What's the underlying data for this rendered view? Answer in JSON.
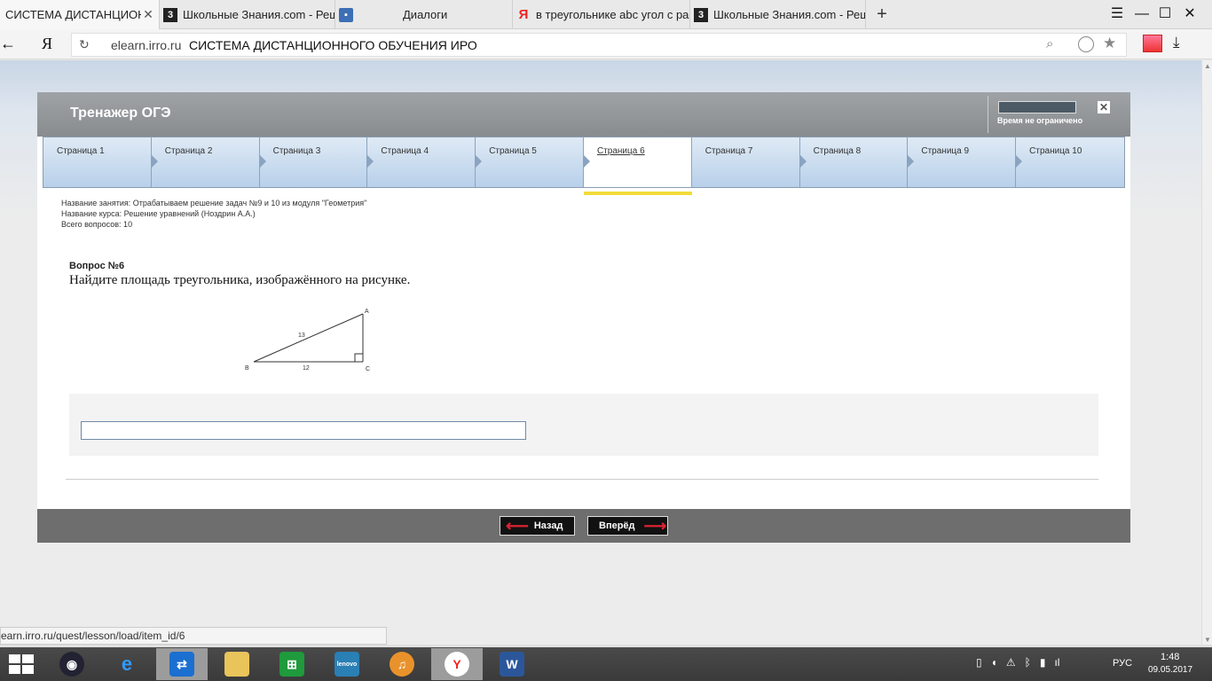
{
  "browser": {
    "tabs": [
      {
        "label": "СИСТЕМА ДИСТАНЦИОННОГО ОБУЧЕНИЯ ИРО",
        "icon": "none",
        "active": true
      },
      {
        "label": "Школьные Знания.com - Решение",
        "icon": "znania-icon"
      },
      {
        "label": "Диалоги",
        "icon": "dialogs-icon"
      },
      {
        "label": "в треугольнике abc угол с равен",
        "icon": "yandex-icon"
      },
      {
        "label": "Школьные Знания.com - Решение",
        "icon": "znania-icon"
      }
    ],
    "new_tab": "+",
    "ya_logo": "Я",
    "url_host": "elearn.irro.ru",
    "url_title": "СИСТЕМА ДИСТАНЦИОННОГО ОБУЧЕНИЯ ИРО",
    "status_url": "earn.irro.ru/quest/lesson/load/item_id/6"
  },
  "trainer": {
    "title": "Тренажер ОГЭ",
    "timer_text": "Время не ограничено",
    "pages": [
      "Страница 1",
      "Страница 2",
      "Страница 3",
      "Страница 4",
      "Страница 5",
      "Страница 6",
      "Страница 7",
      "Страница 8",
      "Страница 9",
      "Страница 10"
    ],
    "active_page": 6,
    "meta": {
      "lesson": "Название занятия: Отрабатываем решение задач №9 и 10 из модуля \"Геометрия\"",
      "course": "Название курса: Решение уравнений (Ноздрин А.А.)",
      "total": "Всего вопросов: 10"
    },
    "question": {
      "number": "Вопрос №6",
      "text": "Найдите площадь треугольника, изображённого на рисунке.",
      "figure": {
        "vertex_a": "A",
        "vertex_b": "B",
        "vertex_c": "C",
        "hyp_label": "13",
        "leg_label": "12"
      }
    },
    "answer_value": "",
    "back_label": "Назад",
    "next_label": "Вперёд"
  },
  "taskbar": {
    "lang": "РУС",
    "time": "1:48",
    "date": "09.05.2017"
  }
}
